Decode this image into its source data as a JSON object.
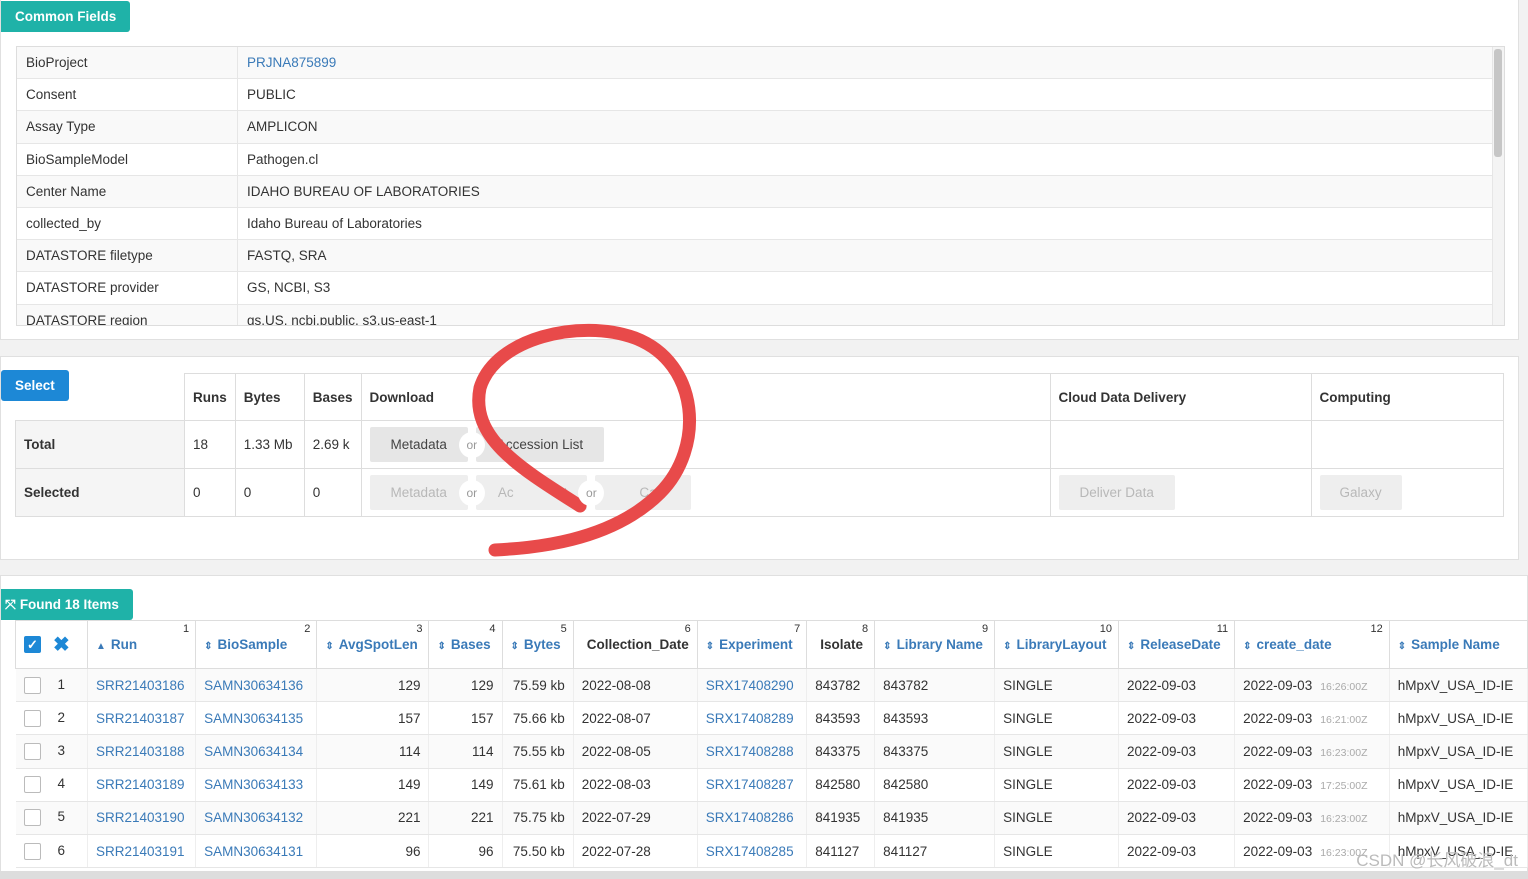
{
  "common": {
    "tag": "Common Fields",
    "rows": [
      {
        "key": "BioProject",
        "value": "PRJNA875899"
      },
      {
        "key": "Consent",
        "value": "PUBLIC"
      },
      {
        "key": "Assay Type",
        "value": "AMPLICON"
      },
      {
        "key": "BioSampleModel",
        "value": "Pathogen.cl"
      },
      {
        "key": "Center Name",
        "value": "IDAHO BUREAU OF LABORATORIES"
      },
      {
        "key": "collected_by",
        "value": "Idaho Bureau of Laboratories"
      },
      {
        "key": "DATASTORE filetype",
        "value": "FASTQ, SRA"
      },
      {
        "key": "DATASTORE provider",
        "value": "GS, NCBI, S3"
      },
      {
        "key": "DATASTORE region",
        "value": "gs.US, ncbi.public, s3.us-east-1"
      }
    ]
  },
  "select": {
    "tag": "Select",
    "headers": {
      "runs": "Runs",
      "bytes": "Bytes",
      "bases": "Bases",
      "download": "Download",
      "cloud": "Cloud Data Delivery",
      "computing": "Computing"
    },
    "total": {
      "label": "Total",
      "runs": "18",
      "bytes": "1.33 Mb",
      "bases": "2.69 k",
      "metadata": "Metadata",
      "or": "or",
      "accession": "Accession List"
    },
    "selected": {
      "label": "Selected",
      "runs": "0",
      "bytes": "0",
      "bases": "0",
      "metadata": "Metadata",
      "or1": "or",
      "accession": "Ac",
      "accession_tail": "t",
      "or2": "or",
      "cart": "Cart",
      "deliver": "Deliver Data",
      "galaxy": "Galaxy"
    }
  },
  "found": {
    "tag": "Found 18 Items",
    "columns": [
      {
        "label": "Run",
        "n": "1"
      },
      {
        "label": "BioSample",
        "n": "2"
      },
      {
        "label": "AvgSpotLen",
        "n": "3"
      },
      {
        "label": "Bases",
        "n": "4"
      },
      {
        "label": "Bytes",
        "n": "5"
      },
      {
        "label": "Collection_Date",
        "n": "6"
      },
      {
        "label": "Experiment",
        "n": "7"
      },
      {
        "label": "Isolate",
        "n": "8"
      },
      {
        "label": "Library Name",
        "n": "9"
      },
      {
        "label": "LibraryLayout",
        "n": "10"
      },
      {
        "label": "ReleaseDate",
        "n": "11"
      },
      {
        "label": "create_date",
        "n": "12"
      },
      {
        "label": "Sample Name",
        "n": ""
      }
    ],
    "rows": [
      {
        "i": "1",
        "run": "SRR21403186",
        "bs": "SAMN30634136",
        "avg": "129",
        "bases": "129",
        "bytes": "75.59 kb",
        "cdate": "2022-08-08",
        "exp": "SRX17408290",
        "iso": "843782",
        "lib": "843782",
        "layout": "SINGLE",
        "rel": "2022-09-03",
        "cr": "2022-09-03",
        "crt": "16:26:00Z",
        "sn": "hMpxV_USA_ID-IE"
      },
      {
        "i": "2",
        "run": "SRR21403187",
        "bs": "SAMN30634135",
        "avg": "157",
        "bases": "157",
        "bytes": "75.66 kb",
        "cdate": "2022-08-07",
        "exp": "SRX17408289",
        "iso": "843593",
        "lib": "843593",
        "layout": "SINGLE",
        "rel": "2022-09-03",
        "cr": "2022-09-03",
        "crt": "16:21:00Z",
        "sn": "hMpxV_USA_ID-IE"
      },
      {
        "i": "3",
        "run": "SRR21403188",
        "bs": "SAMN30634134",
        "avg": "114",
        "bases": "114",
        "bytes": "75.55 kb",
        "cdate": "2022-08-05",
        "exp": "SRX17408288",
        "iso": "843375",
        "lib": "843375",
        "layout": "SINGLE",
        "rel": "2022-09-03",
        "cr": "2022-09-03",
        "crt": "16:23:00Z",
        "sn": "hMpxV_USA_ID-IE"
      },
      {
        "i": "4",
        "run": "SRR21403189",
        "bs": "SAMN30634133",
        "avg": "149",
        "bases": "149",
        "bytes": "75.61 kb",
        "cdate": "2022-08-03",
        "exp": "SRX17408287",
        "iso": "842580",
        "lib": "842580",
        "layout": "SINGLE",
        "rel": "2022-09-03",
        "cr": "2022-09-03",
        "crt": "17:25:00Z",
        "sn": "hMpxV_USA_ID-IE"
      },
      {
        "i": "5",
        "run": "SRR21403190",
        "bs": "SAMN30634132",
        "avg": "221",
        "bases": "221",
        "bytes": "75.75 kb",
        "cdate": "2022-07-29",
        "exp": "SRX17408286",
        "iso": "841935",
        "lib": "841935",
        "layout": "SINGLE",
        "rel": "2022-09-03",
        "cr": "2022-09-03",
        "crt": "16:23:00Z",
        "sn": "hMpxV_USA_ID-IE"
      },
      {
        "i": "6",
        "run": "SRR21403191",
        "bs": "SAMN30634131",
        "avg": "96",
        "bases": "96",
        "bytes": "75.50 kb",
        "cdate": "2022-07-28",
        "exp": "SRX17408285",
        "iso": "841127",
        "lib": "841127",
        "layout": "SINGLE",
        "rel": "2022-09-03",
        "cr": "2022-09-03",
        "crt": "16:23:00Z",
        "sn": "hMpxV_USA_ID-IE"
      }
    ]
  },
  "watermark": "CSDN @长风破浪_dt",
  "colors": {
    "teal": "#1fb2a8",
    "blue": "#1d88d6",
    "link": "#3a7ab8",
    "annotation": "#e84a4a"
  }
}
